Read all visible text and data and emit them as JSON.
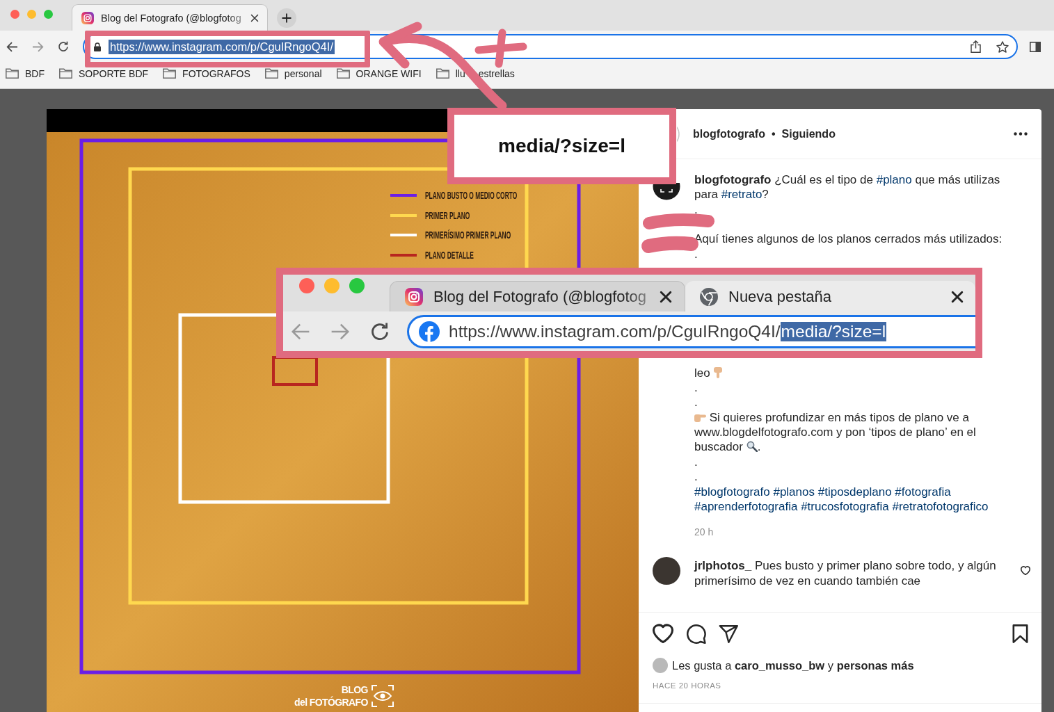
{
  "browser": {
    "tabs": [
      {
        "kind": "site",
        "title": "Blog del Fotografo (@blogfotog",
        "selected": true
      }
    ],
    "address": {
      "url": "https://www.instagram.com/p/CguIRngoQ4I/",
      "selected": true
    },
    "bookmarks": [
      {
        "label": "BDF"
      },
      {
        "label": "SOPORTE BDF"
      },
      {
        "label": "FOTOGRAFOS"
      },
      {
        "label": "personal"
      },
      {
        "label": "ORANGE WIFI"
      },
      {
        "label": "llu",
        "label_rest": "estrellas"
      }
    ]
  },
  "post": {
    "image": {
      "legend": [
        {
          "label": "PLANO BUSTO O MEDIO CORTO",
          "color": "#6b1ee6"
        },
        {
          "label": "PRIMER PLANO",
          "color": "#ffd84f"
        },
        {
          "label": "PRIMERÍSIMO PRIMER PLANO",
          "color": "#ffffff"
        },
        {
          "label": "PLANO DETALLE",
          "color": "#b8261f"
        }
      ],
      "logo": [
        "BLOG",
        "del FOTÓGRAFO"
      ]
    },
    "header": {
      "username": "blogfotografo",
      "separator": "•",
      "follow": "Siguiendo"
    },
    "caption": [
      {
        "parts": [
          {
            "kind": "user",
            "text": "blogfotografo"
          },
          {
            "kind": "text",
            "text": " ¿Cuál es el tipo de "
          },
          {
            "kind": "tag",
            "text": "#plano"
          },
          {
            "kind": "text",
            "text": " que más utilizas para "
          },
          {
            "kind": "tag",
            "text": "#retrato"
          },
          {
            "kind": "text",
            "text": "?"
          }
        ]
      },
      {
        "parts": [
          {
            "kind": "text",
            "text": "."
          }
        ]
      },
      {
        "spaced": true,
        "parts": [
          {
            "kind": "text",
            "text": "Aquí tienes algunos de los planos cerrados más utilizados:"
          }
        ]
      },
      {
        "parts": [
          {
            "kind": "text",
            "text": "."
          }
        ]
      },
      {
        "after_overlay": true,
        "parts": [
          {
            "kind": "text",
            "text": "leo "
          },
          {
            "kind": "emoji"
          }
        ]
      },
      {
        "parts": [
          {
            "kind": "text",
            "text": "."
          }
        ]
      },
      {
        "parts": [
          {
            "kind": "text",
            "text": "."
          }
        ]
      },
      {
        "parts": [
          {
            "kind": "emoji"
          },
          {
            "kind": "text",
            "text": " Si quieres profundizar en más tipos de plano ve a www.blogdelfotografo.com y pon ‘tipos de plano’ en el buscador "
          },
          {
            "kind": "emoji"
          },
          {
            "kind": "text",
            "text": "."
          }
        ]
      },
      {
        "parts": [
          {
            "kind": "text",
            "text": "."
          }
        ]
      },
      {
        "parts": [
          {
            "kind": "text",
            "text": "."
          }
        ]
      },
      {
        "parts": [
          {
            "kind": "tag",
            "text": "#blogfotografo"
          },
          {
            "kind": "tag",
            "text": "#planos"
          },
          {
            "kind": "tag",
            "text": "#tiposdeplano"
          },
          {
            "kind": "tag",
            "text": "#fotografia"
          },
          {
            "kind": "tag",
            "text": "#aprenderfotografia"
          },
          {
            "kind": "tag",
            "text": "#trucosfotografia"
          },
          {
            "kind": "tag",
            "text": "#retratofotografico"
          }
        ]
      }
    ],
    "caption_time": "20 h",
    "comments": [
      {
        "parts": [
          {
            "kind": "user",
            "text": "jrlphotos_"
          },
          {
            "kind": "text",
            "text": " Pues busto y primer plano sobre todo, y algún primerísimo de vez en cuando también cae"
          }
        ],
        "liked": false
      }
    ],
    "actions": {
      "liked": false,
      "saved": false
    },
    "likes": "Les gusta a **caro_musso_bw** y **personas más**",
    "timestamp": "HACE 20 HORAS"
  },
  "annotations": {
    "callout": "media/?size=l",
    "inset": {
      "tabs": [
        {
          "kind": "site",
          "title": "Blog del Fotografo (@blogfotog",
          "selected": false
        },
        {
          "kind": "newtab",
          "title": "Nueva pestaña",
          "selected": true
        }
      ],
      "url": "https://www.instagram.com/p/CguIRngoQ4I/",
      "url_selection": "media/?size=l"
    }
  }
}
